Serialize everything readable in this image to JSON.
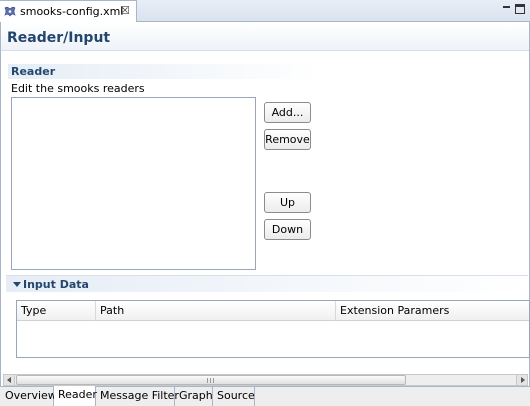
{
  "editor": {
    "tab_title": "smooks-config.xml",
    "close_glyph": "☒"
  },
  "form": {
    "title": "Reader/Input"
  },
  "reader": {
    "section_title": "Reader",
    "description": "Edit the smooks readers",
    "buttons": {
      "add": "Add...",
      "remove": "Remove",
      "up": "Up",
      "down": "Down"
    }
  },
  "input_data": {
    "section_title": "Input Data",
    "columns": [
      "Type",
      "Path",
      "Extension Paramers"
    ]
  },
  "page_tabs": [
    "Overview",
    "Reader",
    "Message Filter",
    "Graph",
    "Source"
  ],
  "active_page_tab": "Reader",
  "colors": {
    "section_title": "#25476d",
    "tabbar_bg": "#d9e2ef"
  }
}
